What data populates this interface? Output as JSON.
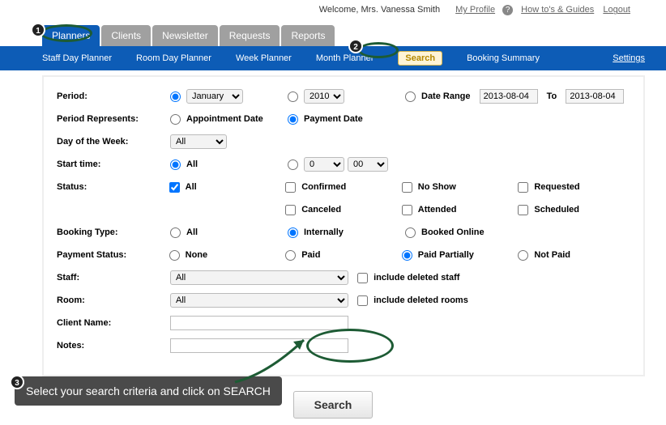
{
  "header": {
    "welcome": "Welcome, Mrs. Vanessa Smith",
    "myprofile": "My Profile",
    "howto": "How to's & Guides",
    "logout": "Logout"
  },
  "tabs": {
    "planners": "Planners",
    "clients": "Clients",
    "newsletter": "Newsletter",
    "requests": "Requests",
    "reports": "Reports"
  },
  "subnav": {
    "staffday": "Staff Day Planner",
    "roomday": "Room Day Planner",
    "week": "Week Planner",
    "month": "Month Planner",
    "search": "Search",
    "booking": "Booking Summary",
    "settings": "Settings"
  },
  "form": {
    "period_label": "Period:",
    "period_month": "January",
    "period_year": "2010",
    "daterange_label": "Date Range",
    "date_from": "2013-08-04",
    "to": "To",
    "date_to": "2013-08-04",
    "periodrep_label": "Period Represents:",
    "appt_date": "Appointment Date",
    "payment_date": "Payment Date",
    "dow_label": "Day of the Week:",
    "dow_value": "All",
    "start_label": "Start time:",
    "start_all": "All",
    "start_h": "0",
    "start_m": "00",
    "status_label": "Status:",
    "status_all": "All",
    "status_confirmed": "Confirmed",
    "status_noshow": "No Show",
    "status_requested": "Requested",
    "status_canceled": "Canceled",
    "status_attended": "Attended",
    "status_scheduled": "Scheduled",
    "booking_label": "Booking Type:",
    "booking_all": "All",
    "booking_internal": "Internally",
    "booking_online": "Booked Online",
    "pay_label": "Payment Status:",
    "pay_none": "None",
    "pay_paid": "Paid",
    "pay_partial": "Paid Partially",
    "pay_notpaid": "Not Paid",
    "staff_label": "Staff:",
    "staff_value": "All",
    "staff_deleted": "include deleted staff",
    "room_label": "Room:",
    "room_value": "All",
    "room_deleted": "include deleted rooms",
    "client_label": "Client Name:",
    "notes_label": "Notes:",
    "search_btn": "Search"
  },
  "annotations": {
    "b1": "1",
    "b2": "2",
    "b3": "3",
    "callout": "Select your search criteria and click on SEARCH"
  }
}
